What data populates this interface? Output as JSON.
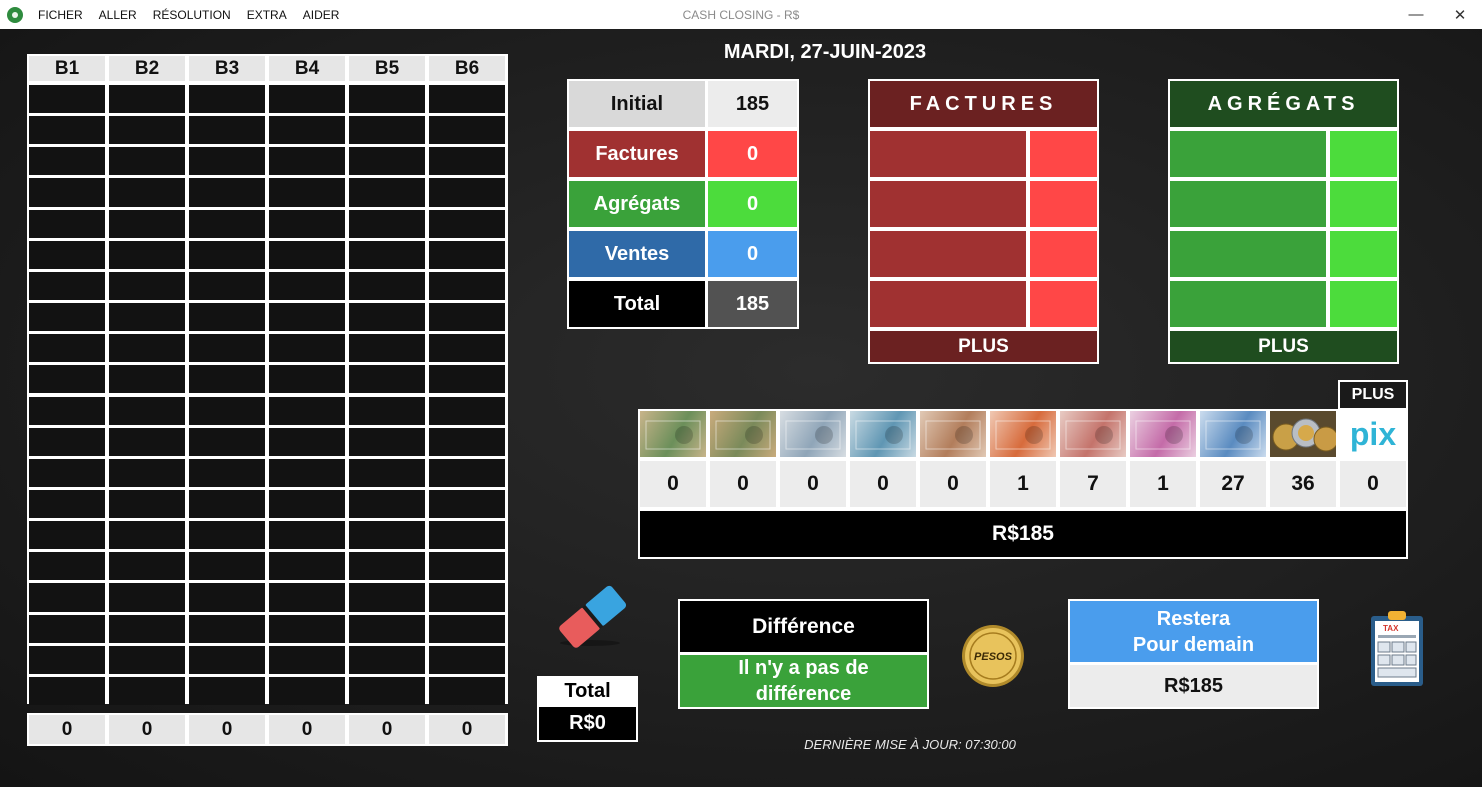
{
  "window": {
    "title": "CASH CLOSING - R$",
    "menu": [
      "FICHER",
      "ALLER",
      "RÉSOLUTION",
      "EXTRA",
      "AIDER"
    ],
    "minimize": "—",
    "close": "✕"
  },
  "boxes": {
    "headers": [
      "B1",
      "B2",
      "B3",
      "B4",
      "B5",
      "B6"
    ],
    "totals": [
      "0",
      "0",
      "0",
      "0",
      "0",
      "0"
    ]
  },
  "date": "MARDI, 27-JUIN-2023",
  "summary": {
    "initial_label": "Initial",
    "initial_value": "185",
    "factures_label": "Factures",
    "factures_value": "0",
    "agregats_label": "Agrégats",
    "agregats_value": "0",
    "ventes_label": "Ventes",
    "ventes_value": "0",
    "total_label": "Total",
    "total_value": "185"
  },
  "factures_panel": {
    "title": "FACTURES",
    "plus": "PLUS"
  },
  "agregats_panel": {
    "title": "AGRÉGATS",
    "plus": "PLUS"
  },
  "denominations": {
    "plus": "PLUS",
    "pix_label": "pix",
    "counts": [
      "0",
      "0",
      "0",
      "0",
      "0",
      "1",
      "7",
      "1",
      "27",
      "36",
      "0"
    ],
    "total": "R$185"
  },
  "left_total": {
    "label": "Total",
    "value": "R$0"
  },
  "difference": {
    "label": "Différence",
    "line1": "Il n'y a pas de",
    "line2": "différence"
  },
  "coin_label": "PESOS",
  "tomorrow": {
    "line1": "Restera",
    "line2": "Pour demain",
    "value": "R$185"
  },
  "tax_icon_label": "TAX",
  "last_update": "DERNIÈRE MISE À JOUR: 07:30:00",
  "colors": {
    "red_dark": "#6b2121",
    "red_mid": "#a03131",
    "red_bright": "#ff4747",
    "green_dark": "#1f4d1f",
    "green_mid": "#3aa23a",
    "green_bright": "#4cdc3c",
    "blue_mid": "#2f6aa8",
    "blue_bright": "#4a9ded"
  }
}
